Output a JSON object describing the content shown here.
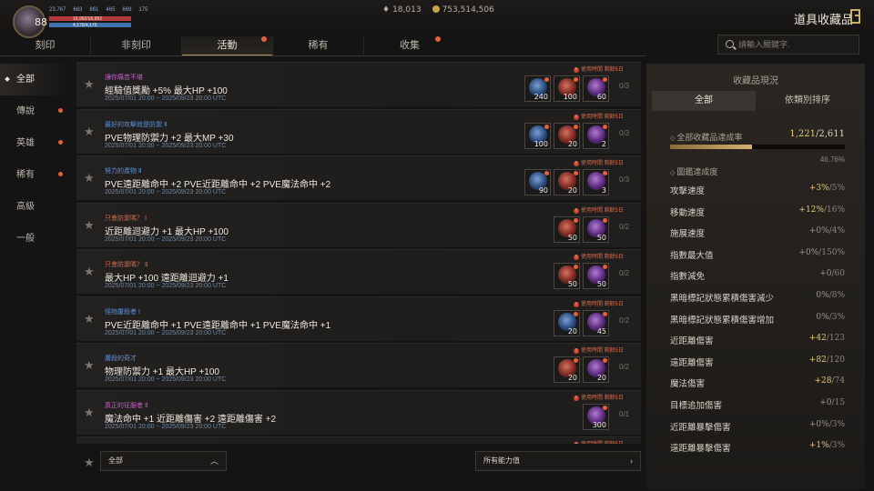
{
  "player": {
    "level": "88",
    "stats": [
      "23,767",
      "663",
      "861",
      "465",
      "669",
      "175"
    ],
    "hp_text": "16,992/16,992",
    "mp_text": "4,176/4,176"
  },
  "currency": {
    "wings": "18,013",
    "gold": "753,514,506"
  },
  "header": {
    "title": "道具收藏品"
  },
  "tabs": [
    {
      "label": "刻印",
      "dot": false
    },
    {
      "label": "非刻印",
      "dot": false
    },
    {
      "label": "活動",
      "dot": true,
      "active": true
    },
    {
      "label": "稀有",
      "dot": false
    },
    {
      "label": "收集",
      "dot": true
    }
  ],
  "search": {
    "placeholder": "請輸入關鍵字."
  },
  "sidebar": {
    "items": [
      {
        "label": "全部",
        "active": true,
        "dot": false
      },
      {
        "label": "傳說",
        "dot": true
      },
      {
        "label": "英雄",
        "dot": true
      },
      {
        "label": "稀有",
        "dot": true
      },
      {
        "label": "高級",
        "dot": false
      },
      {
        "label": "一般",
        "dot": false
      }
    ]
  },
  "collections": [
    {
      "name": "讓你痛苦不堪",
      "name_color": "#c95fc9",
      "stat": "經驗值獎勵 +5% 最大HP +100",
      "date": "2025/07/01 20:00 ~ 2025/09/23 20:00 UTC",
      "badge": "使用時間 剩餘5日",
      "count": "0/3",
      "items": [
        {
          "color": "blue",
          "qty": "240",
          "dot": true
        },
        {
          "color": "red",
          "qty": "100",
          "dot": true
        },
        {
          "color": "purple",
          "qty": "60",
          "dot": true
        }
      ]
    },
    {
      "name": "最好的攻擊就是防禦 Ⅱ",
      "name_color": "#5b8fd6",
      "stat": "PVE物理防禦力 +2 最大MP +30",
      "date": "2025/07/01 20:00 ~ 2025/09/23 20:00 UTC",
      "badge": "使用時間 剩餘5日",
      "count": "0/3",
      "items": [
        {
          "color": "blue",
          "qty": "100",
          "dot": true
        },
        {
          "color": "red",
          "qty": "20",
          "dot": true
        },
        {
          "color": "purple",
          "qty": "2",
          "dot": true
        }
      ]
    },
    {
      "name": "努力的產物 Ⅱ",
      "name_color": "#5b8fd6",
      "stat": "PVE遠距離命中 +2 PVE近距離命中 +2 PVE魔法命中 +2",
      "date": "2025/07/01 20:00 ~ 2025/09/23 20:00 UTC",
      "badge": "使用時間 剩餘5日",
      "count": "0/3",
      "items": [
        {
          "color": "blue",
          "qty": "90",
          "dot": true
        },
        {
          "color": "red",
          "qty": "20",
          "dot": true
        },
        {
          "color": "purple",
          "qty": "3",
          "dot": true
        }
      ]
    },
    {
      "name": "只會防禦嗎？ Ⅰ",
      "name_color": "#d4694a",
      "stat": "近距離迴避力 +1 最大HP +100",
      "date": "2025/07/01 20:00 ~ 2025/09/23 20:00 UTC",
      "badge": "使用時間 剩餘5日",
      "count": "0/2",
      "items": [
        {
          "color": "red",
          "qty": "50",
          "dot": true
        },
        {
          "color": "purple",
          "qty": "50",
          "dot": true
        }
      ]
    },
    {
      "name": "只會防禦嗎？ Ⅱ",
      "name_color": "#d4694a",
      "stat": "最大HP +100 遠距離迴避力 +1",
      "date": "2025/07/01 20:00 ~ 2025/09/23 20:00 UTC",
      "badge": "使用時間 剩餘5日",
      "count": "0/2",
      "items": [
        {
          "color": "red",
          "qty": "50",
          "dot": true
        },
        {
          "color": "purple",
          "qty": "50",
          "dot": true
        }
      ]
    },
    {
      "name": "怪物屠殺者 Ⅰ",
      "name_color": "#5b8fd6",
      "stat": "PVE近距離命中 +1 PVE遠距離命中 +1 PVE魔法命中 +1",
      "date": "2025/07/01 20:00 ~ 2025/09/23 20:00 UTC",
      "badge": "使用時間 剩餘5日",
      "count": "0/2",
      "items": [
        {
          "color": "blue",
          "qty": "20",
          "dot": true
        },
        {
          "color": "purple",
          "qty": "45",
          "dot": true
        }
      ]
    },
    {
      "name": "屠殺的奇才",
      "name_color": "#5b8fd6",
      "stat": "物理防禦力 +1 最大HP +100",
      "date": "2025/07/01 20:00 ~ 2025/09/23 20:00 UTC",
      "badge": "使用時間 剩餘5日",
      "count": "0/2",
      "items": [
        {
          "color": "red",
          "qty": "20",
          "dot": true
        },
        {
          "color": "purple",
          "qty": "20",
          "dot": true
        }
      ]
    },
    {
      "name": "真正的征服者 Ⅱ",
      "name_color": "#c95fc9",
      "stat": "魔法命中 +1 近距離傷害 +2 遠距離傷害 +2",
      "date": "2025/07/01 20:00 ~ 2025/09/23 20:00 UTC",
      "badge": "使用時間 剩餘5日",
      "count": "0/1",
      "items": [
        {
          "color": "purple",
          "qty": "300",
          "dot": true
        }
      ]
    },
    {
      "name": "",
      "name_color": "#c95fc9",
      "stat": "",
      "date": "",
      "badge": "使用時間 剩餘5日",
      "count": "",
      "items": []
    }
  ],
  "bottom": {
    "filter_label": "全部",
    "ability_label": "所有能力值"
  },
  "panel": {
    "title": "收藏品現況",
    "tabs": [
      "全部",
      "依類別排序"
    ],
    "completion_label": "全部收藏品達成率",
    "completion_current": "1,221",
    "completion_total": "/2,611",
    "completion_pct": "46.76%",
    "completion_fraction": 0.4676,
    "section_label": "圖鑑達成度",
    "stats": [
      {
        "label": "攻擊速度",
        "cur": "+3%",
        "total": "/5%",
        "highlight": true
      },
      {
        "label": "移動速度",
        "cur": "+12%",
        "total": "/16%",
        "highlight": true
      },
      {
        "label": "施展速度",
        "cur": "+0%",
        "total": "/4%",
        "highlight": false
      },
      {
        "label": "指數最大值",
        "cur": "+0%",
        "total": "/150%",
        "highlight": false
      },
      {
        "label": "指數減免",
        "cur": "+0",
        "total": "/60",
        "highlight": false
      },
      {
        "label": "黑暗標記狀態累積傷害減少",
        "cur": "0%",
        "total": "/8%",
        "highlight": false
      },
      {
        "label": "黑暗標記狀態累積傷害增加",
        "cur": "0%",
        "total": "/3%",
        "highlight": false
      },
      {
        "label": "近距離傷害",
        "cur": "+42",
        "total": "/123",
        "highlight": true
      },
      {
        "label": "遠距離傷害",
        "cur": "+82",
        "total": "/120",
        "highlight": true
      },
      {
        "label": "魔法傷害",
        "cur": "+28",
        "total": "/74",
        "highlight": true
      },
      {
        "label": "目標追加傷害",
        "cur": "+0",
        "total": "/15",
        "highlight": false
      },
      {
        "label": "近距離暴擊傷害",
        "cur": "+0%",
        "total": "/3%",
        "highlight": false
      },
      {
        "label": "遠距離暴擊傷害",
        "cur": "+1%",
        "total": "/3%",
        "highlight": true
      }
    ]
  },
  "colors": {
    "accent": "#a88f5e",
    "alert": "#e0623d",
    "gold_text": "#e6c87a"
  }
}
